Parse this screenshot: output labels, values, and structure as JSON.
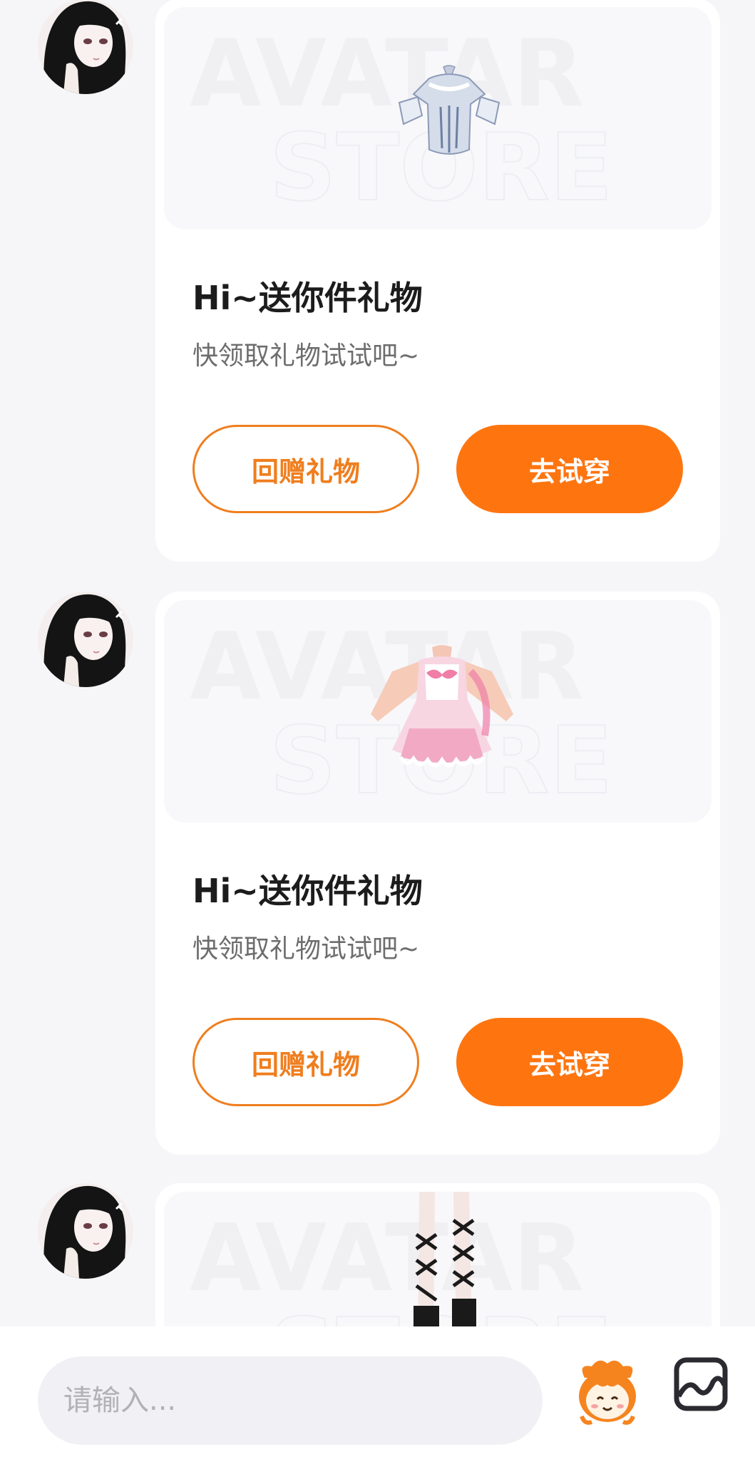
{
  "messages": [
    {
      "title": "Hi~送你件礼物",
      "subtitle": "快领取礼物试试吧~",
      "gift_back_label": "回赠礼物",
      "try_on_label": "去试穿",
      "watermark_line1": "AVATAR",
      "watermark_line2": "STORE",
      "item_icon": "blue-dress-icon"
    },
    {
      "title": "Hi~送你件礼物",
      "subtitle": "快领取礼物试试吧~",
      "gift_back_label": "回赠礼物",
      "try_on_label": "去试穿",
      "watermark_line1": "AVATAR",
      "watermark_line2": "STORE",
      "item_icon": "pink-maid-dress-icon"
    },
    {
      "watermark_line1": "AVATAR",
      "watermark_line2": "STORE",
      "item_icon": "lace-up-boots-icon"
    }
  ],
  "composer": {
    "placeholder": "请输入...",
    "mascot_icon": "mascot-emoji-icon",
    "image_icon": "image-icon"
  },
  "colors": {
    "accent": "#fe7510",
    "outline_accent": "#ef7e1e",
    "background": "#f6f6f9"
  }
}
